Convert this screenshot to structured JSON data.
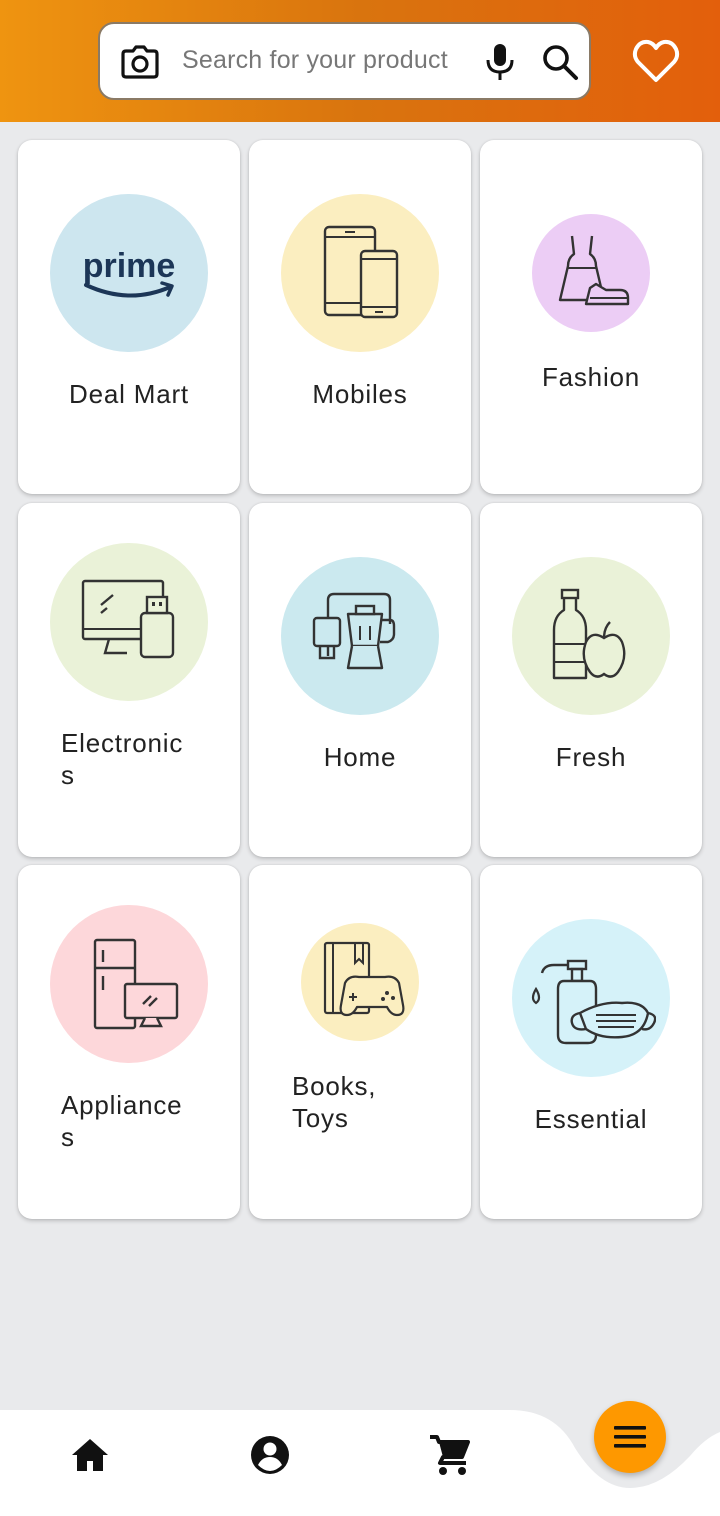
{
  "search": {
    "placeholder": "Search for your product"
  },
  "colors": {
    "header_start": "#ef9410",
    "header_end": "#e35f0c",
    "fab": "#fe9800",
    "background": "#e9eaec"
  },
  "categories": [
    {
      "label": "Deal Mart",
      "icon": "prime-logo-icon",
      "circle_color": "#cde6ef"
    },
    {
      "label": "Mobiles",
      "icon": "mobile-devices-icon",
      "circle_color": "#fbeec0"
    },
    {
      "label": "Fashion",
      "icon": "dress-shoe-icon",
      "circle_color": "#eccdf5"
    },
    {
      "label": "Electronic\ns",
      "icon": "monitor-usb-icon",
      "circle_color": "#eaf2d8"
    },
    {
      "label": "Home",
      "icon": "blender-appliance-icon",
      "circle_color": "#cbe9ef"
    },
    {
      "label": "Fresh",
      "icon": "bottle-apple-icon",
      "circle_color": "#eaf2d8"
    },
    {
      "label": "Appliance\ns",
      "icon": "fridge-tv-icon",
      "circle_color": "#fdd7da"
    },
    {
      "label": "Books,\nToys",
      "icon": "book-gamepad-icon",
      "circle_color": "#fbeec0"
    },
    {
      "label": "Essential",
      "icon": "sanitizer-mask-icon",
      "circle_color": "#d5f2f9"
    }
  ],
  "prime_logo_text": "prime",
  "bottom_nav": [
    {
      "icon": "home-icon"
    },
    {
      "icon": "account-icon"
    },
    {
      "icon": "cart-icon"
    },
    {
      "icon": "menu-icon"
    }
  ]
}
